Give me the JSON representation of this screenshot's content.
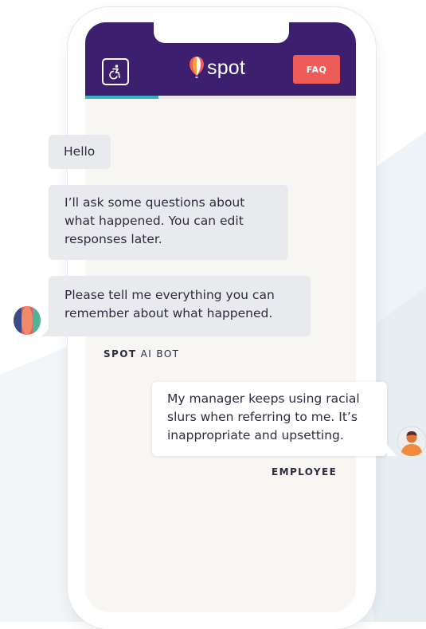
{
  "header": {
    "logo_text": "spot",
    "faq_label": "FAQ",
    "accessibility_icon": "accessibility-icon",
    "brand_color": "#3c1f6e",
    "faq_color": "#ee5c59"
  },
  "progress": {
    "fraction": 0.27,
    "color": "#3bb0c3"
  },
  "messages": [
    {
      "from": "bot",
      "lines": [
        "Hello"
      ]
    },
    {
      "from": "bot",
      "lines": [
        "I’ll ask some questions about",
        "what happened. You can edit",
        "responses later."
      ]
    },
    {
      "from": "bot",
      "lines": [
        "Please tell me everything you can",
        "remember about what happened."
      ]
    },
    {
      "from": "employee",
      "lines": [
        "My manager keeps using racial",
        "slurs when referring to me. It’s",
        "inappropriate and upsetting."
      ]
    }
  ],
  "labels": {
    "bot_name_first": "SPOT",
    "bot_name_rest": "AI BOT",
    "employee": "EMPLOYEE"
  }
}
